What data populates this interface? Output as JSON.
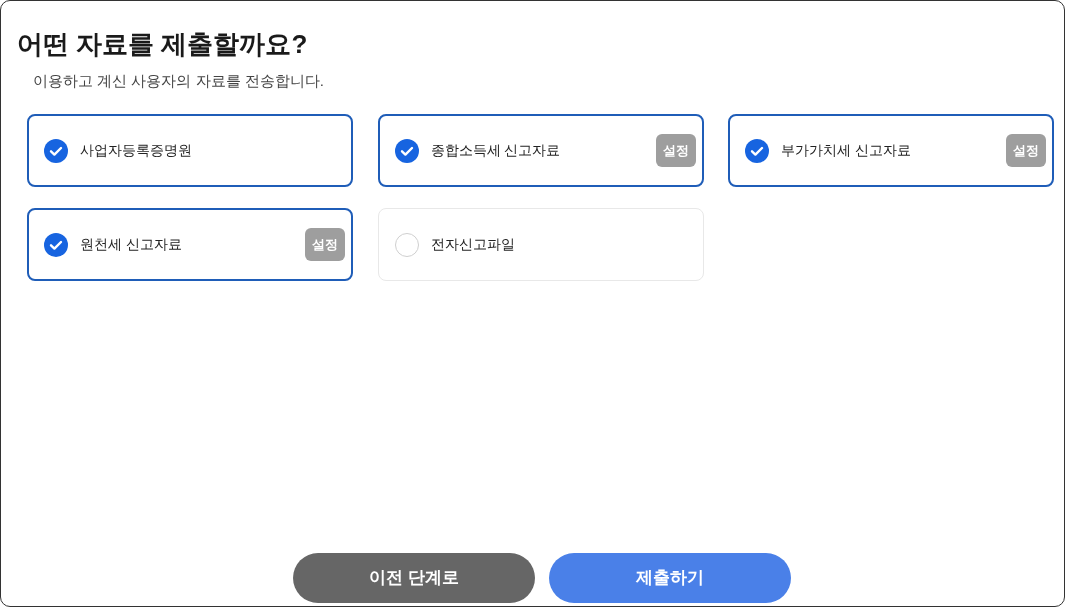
{
  "title": "어떤 자료를 제출할까요?",
  "subtitle": "이용하고 계신 사용자의 자료를 전송합니다.",
  "options": [
    {
      "label": "사업자등록증명원",
      "checked": true
    },
    {
      "label": "종합소득세 신고자료",
      "checked": true,
      "settings_button": "설정"
    },
    {
      "label": "부가가치세 신고자료",
      "checked": true,
      "settings_button": "설정"
    },
    {
      "label": "원천세 신고자료",
      "checked": true,
      "settings_button": "설정"
    },
    {
      "label": "전자신고파일",
      "checked": false
    }
  ],
  "buttons": [
    {
      "label": "이전 단계로",
      "kind": "secondary"
    },
    {
      "label": "제출하기",
      "kind": "primary"
    }
  ]
}
